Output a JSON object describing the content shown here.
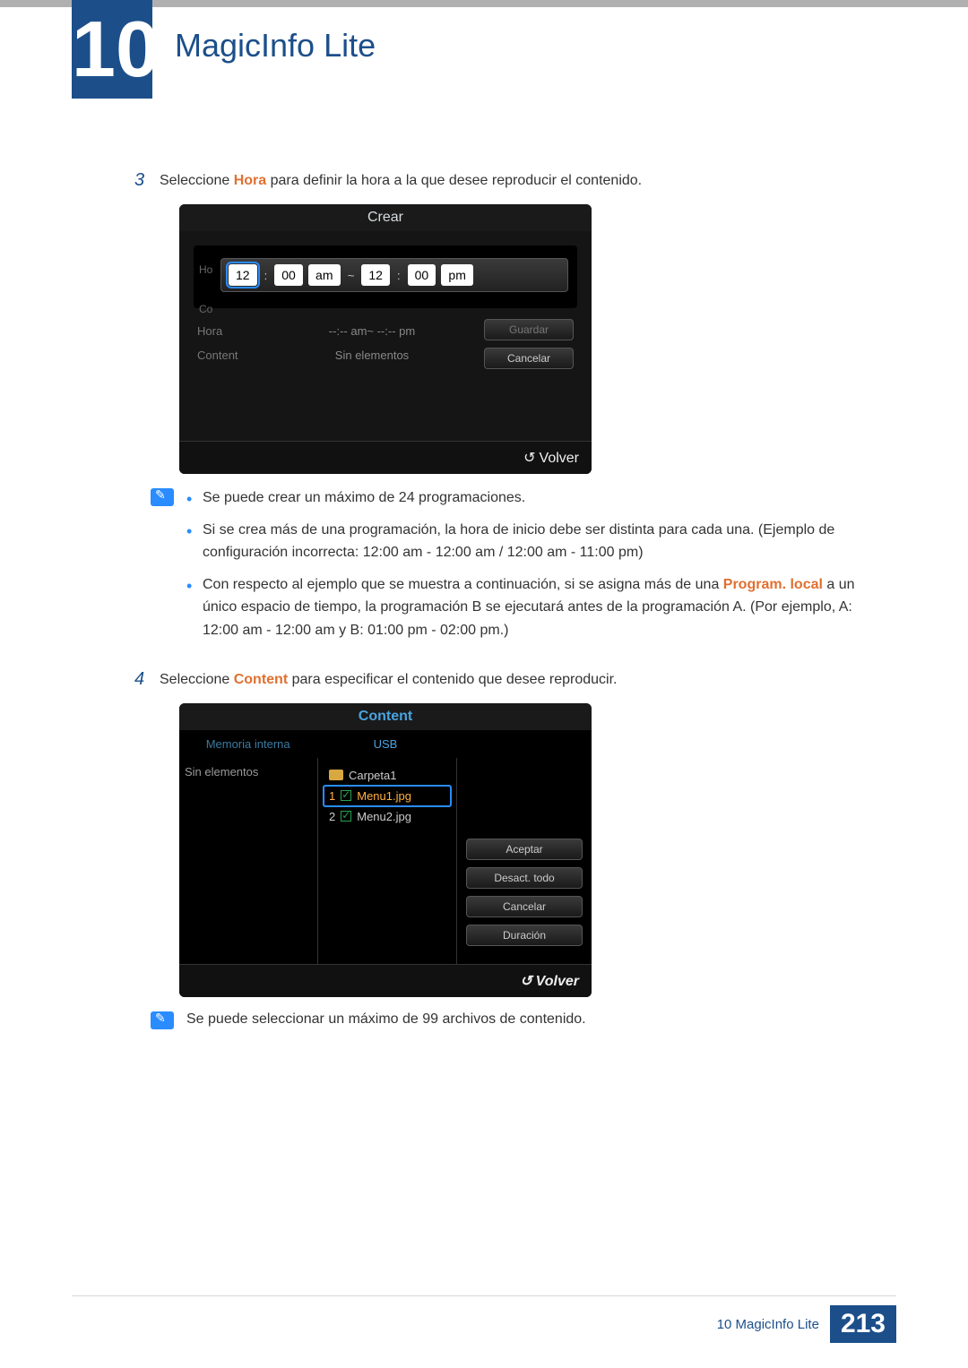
{
  "chapter": {
    "number": "10",
    "title": "MagicInfo Lite"
  },
  "step3": {
    "num": "3",
    "pre": "Seleccione ",
    "keyword": "Hora",
    "post": " para definir la hora a la que desee reproducir el contenido."
  },
  "screenshot1": {
    "title": "Crear",
    "side_label_top": "Ho",
    "side_label_bot": "Co",
    "time": {
      "h1": "12",
      "m1": "00",
      "ampm1": "am",
      "sep": "~",
      "h2": "12",
      "m2": "00",
      "ampm2": "pm"
    },
    "rows": [
      {
        "label": "Hora",
        "value": "--:-- am~ --:-- pm"
      },
      {
        "label": "Content",
        "value": "Sin elementos"
      }
    ],
    "buttons": {
      "save": "Guardar",
      "cancel": "Cancelar"
    },
    "footer": "Volver"
  },
  "notes1": {
    "items": [
      {
        "text": "Se puede crear un máximo de 24 programaciones."
      },
      {
        "text": "Si se crea más de una programación, la hora de inicio debe ser distinta para cada una. (Ejemplo de configuración incorrecta: 12:00 am - 12:00 am / 12:00 am - 11:00 pm)"
      },
      {
        "pre": "Con respecto al ejemplo que se muestra a continuación, si se asigna más de una ",
        "keyword": "Program. local",
        "post": " a un único espacio de tiempo, la programación B se ejecutará antes de la programación A. (Por ejemplo, A: 12:00 am - 12:00 am y B: 01:00 pm - 02:00 pm.)"
      }
    ]
  },
  "step4": {
    "num": "4",
    "pre": "Seleccione ",
    "keyword": "Content",
    "post": " para especificar el contenido que desee reproducir."
  },
  "screenshot2": {
    "title": "Content",
    "tabs": {
      "left": "Memoria interna",
      "right": "USB"
    },
    "col_left": "Sin elementos",
    "files": [
      {
        "idx": "",
        "name": "Carpeta1",
        "type": "folder"
      },
      {
        "idx": "1",
        "name": "Menu1.jpg",
        "selected": true
      },
      {
        "idx": "2",
        "name": "Menu2.jpg"
      }
    ],
    "buttons": {
      "accept": "Aceptar",
      "deselect": "Desact. todo",
      "cancel": "Cancelar",
      "duration": "Duración"
    },
    "footer": "Volver"
  },
  "notes2": {
    "text": "Se puede seleccionar un máximo de 99 archivos de contenido."
  },
  "footer": {
    "label": "10 MagicInfo Lite",
    "page": "213"
  }
}
